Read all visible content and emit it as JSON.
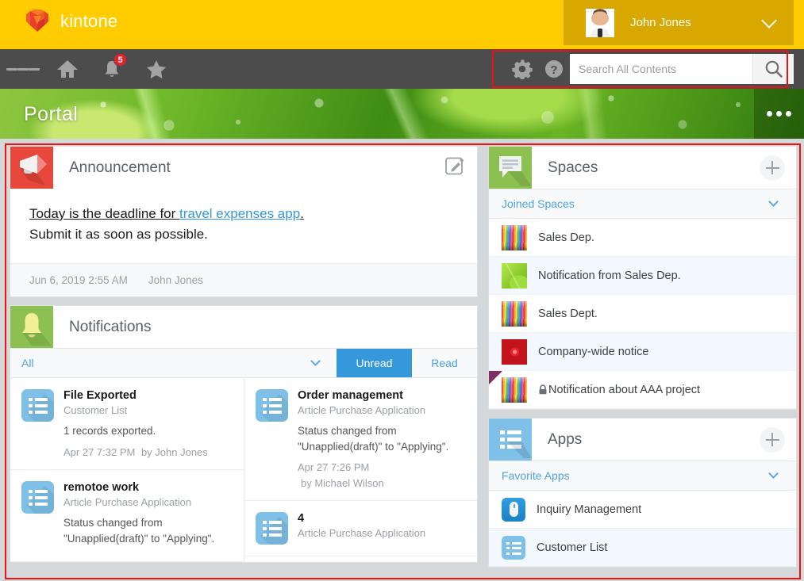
{
  "brand": {
    "name": "kintone",
    "logo_icon": "kintone-cube-logo",
    "bar_color": "#ffcc00"
  },
  "header": {
    "user": {
      "name": "John Jones",
      "avatar_icon": "user-avatar",
      "chevron_icon": "chevron-down-icon"
    }
  },
  "nav": {
    "menu_icon": "hamburger-menu-icon",
    "home_icon": "home-icon",
    "bell_icon": "bell-icon",
    "bell_badge": "5",
    "star_icon": "star-icon",
    "gear_icon": "gear-icon",
    "help_icon": "help-icon",
    "search": {
      "placeholder": "Search All Contents",
      "value": "",
      "icon": "search-icon"
    }
  },
  "banner": {
    "title": "Portal",
    "menu_icon": "ellipsis-icon"
  },
  "announcement": {
    "title": "Announcement",
    "tile_icon": "megaphone-icon",
    "edit_icon": "edit-pencil-icon",
    "line1_prefix": "Today is the deadline for ",
    "line1_link": "travel expenses app",
    "line1_suffix": ".",
    "line2": "Submit it as soon as possible.",
    "timestamp": "Jun 6, 2019 2:55 AM",
    "author": "John Jones"
  },
  "notifications": {
    "title": "Notifications",
    "tile_icon": "bell-icon",
    "filter_label": "All",
    "filter_chevron_icon": "chevron-down-icon",
    "tab_unread": "Unread",
    "tab_read": "Read",
    "active_tab": "Unread",
    "accent_color": "#3498db",
    "items_left": [
      {
        "icon": "app-list-icon",
        "title": "File Exported",
        "app": "Customer List",
        "message": "1 records exported.",
        "time": "Apr 27 7:32 PM",
        "by": "by John Jones"
      },
      {
        "icon": "app-list-icon",
        "title": "remotoe work",
        "app": "Article Purchase Application",
        "message": "Status changed from \"Unapplied(draft)\" to \"Applying\".",
        "time": "",
        "by": ""
      }
    ],
    "items_right": [
      {
        "icon": "app-list-icon",
        "title": "Order management",
        "app": "Article Purchase Application",
        "message": "Status changed from \"Unapplied(draft)\" to \"Applying\".",
        "time": "Apr 27 7:26 PM",
        "by": "by Michael Wilson"
      },
      {
        "icon": "app-list-icon",
        "title": "4",
        "app": "Article Purchase Application",
        "message": "",
        "time": "",
        "by": ""
      }
    ]
  },
  "spaces": {
    "title": "Spaces",
    "tile_icon": "speech-bubble-icon",
    "add_icon": "plus-icon",
    "group_label": "Joined Spaces",
    "group_chevron_icon": "chevron-down-icon",
    "items": [
      {
        "label": "Sales Dep.",
        "thumb": "pencils-thumbnail",
        "private": false
      },
      {
        "label": "Notification from Sales Dep.",
        "thumb": "leaf-thumbnail",
        "private": false
      },
      {
        "label": "Sales Dept.",
        "thumb": "pencils-thumbnail",
        "private": false
      },
      {
        "label": "Company-wide notice",
        "thumb": "rose-thumbnail",
        "private": false
      },
      {
        "label": "Notification about AAA project",
        "thumb": "pencils-thumbnail",
        "private": true
      }
    ]
  },
  "apps": {
    "title": "Apps",
    "tile_icon": "app-list-icon",
    "add_icon": "plus-icon",
    "group_label": "Favorite Apps",
    "group_chevron_icon": "chevron-down-icon",
    "items": [
      {
        "label": "Inquiry Management",
        "icon": "mouse-icon"
      },
      {
        "label": "Customer List",
        "icon": "app-list-icon"
      }
    ]
  }
}
